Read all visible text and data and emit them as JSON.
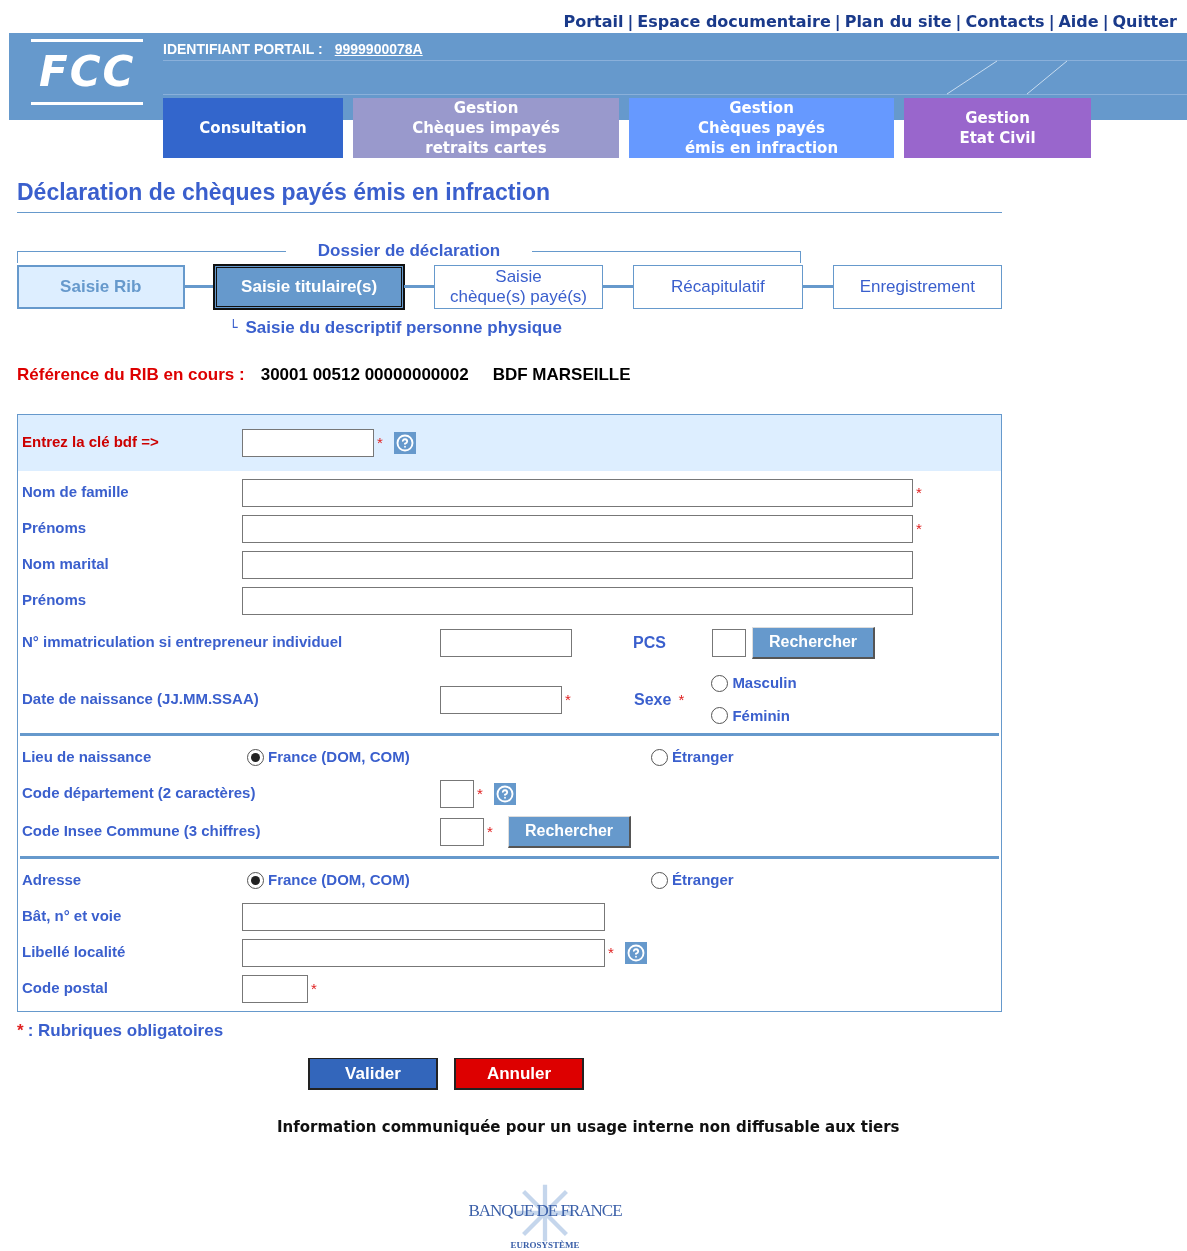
{
  "top_links": {
    "separator": "|",
    "items": [
      "Portail",
      "Espace documentaire",
      "Plan du site",
      "Contacts",
      "Aide",
      "Quitter"
    ]
  },
  "header": {
    "logo": "FCC",
    "portal_id_label": "IDENTIFIANT PORTAIL :",
    "portal_id": "9999900078A"
  },
  "menu_tabs": [
    {
      "lines": [
        "Consultation"
      ],
      "color": "#3366cc"
    },
    {
      "lines": [
        "Gestion",
        "Chèques impayés",
        "retraits cartes"
      ],
      "color": "#9999cc"
    },
    {
      "lines": [
        "Gestion",
        "Chèques payés",
        "émis en infraction"
      ],
      "color": "#6699ff"
    },
    {
      "lines": [
        "Gestion",
        "Etat Civil"
      ],
      "color": "#9966cc"
    }
  ],
  "page_title": "Déclaration de chèques payés émis en infraction",
  "steps": {
    "group_label": "Dossier de déclaration",
    "items": [
      {
        "lines": [
          "Saisie Rib"
        ],
        "kind": "done"
      },
      {
        "lines": [
          "Saisie titulaire(s)"
        ],
        "kind": "current"
      },
      {
        "lines": [
          "Saisie",
          "chèque(s) payé(s)"
        ],
        "kind": "pending"
      },
      {
        "lines": [
          "Récapitulatif"
        ],
        "kind": "pending"
      },
      {
        "lines": [
          "Enregistrement"
        ],
        "kind": "pending"
      }
    ],
    "substep_mark": "└",
    "substep": "Saisie du descriptif personne physique"
  },
  "rib": {
    "label": "Référence du RIB en cours :",
    "value": "30001 00512 00000000002",
    "bank": "BDF MARSEILLE"
  },
  "form": {
    "required_mark": "*",
    "bdf_key": {
      "label": "Entrez la clé bdf =>",
      "required": true,
      "help": true
    },
    "name_fields": [
      {
        "label": "Nom de famille",
        "required": true
      },
      {
        "label": "Prénoms",
        "required": true
      },
      {
        "label": "Nom marital",
        "required": false
      },
      {
        "label": "Prénoms",
        "required": false
      }
    ],
    "registration": {
      "label": "N° immatriculation si entrepreneur individuel"
    },
    "pcs": {
      "label": "PCS",
      "button": "Rechercher"
    },
    "birth_date": {
      "label": "Date de naissance (JJ.MM.SSAA)",
      "required": true
    },
    "sex": {
      "label": "Sexe",
      "required": true,
      "options": [
        {
          "label": "Masculin",
          "selected": false
        },
        {
          "label": "Féminin",
          "selected": false
        }
      ]
    },
    "birth_place": {
      "label": "Lieu de naissance",
      "options": [
        {
          "label": "France (DOM, COM)",
          "selected": true
        },
        {
          "label": "Étranger",
          "selected": false
        }
      ]
    },
    "department": {
      "label": "Code département (2 caractères)",
      "required": true,
      "help": true
    },
    "insee": {
      "label": "Code Insee Commune (3 chiffres)",
      "required": true,
      "button": "Rechercher"
    },
    "address": {
      "label": "Adresse",
      "options": [
        {
          "label": "France (DOM, COM)",
          "selected": true
        },
        {
          "label": "Étranger",
          "selected": false
        }
      ]
    },
    "address_fields": [
      {
        "label": "Bât, n° et voie",
        "required": false,
        "help": false,
        "kind": "long"
      },
      {
        "label": "Libellé localité",
        "required": true,
        "help": true,
        "kind": "long"
      },
      {
        "label": "Code postal",
        "required": true,
        "help": false,
        "kind": "short"
      }
    ]
  },
  "legend": {
    "mark": "*",
    "text": ": Rubriques obligatoires"
  },
  "buttons": [
    {
      "label": "Valider",
      "kind": "primary"
    },
    {
      "label": "Annuler",
      "kind": "cancel"
    }
  ],
  "notice": "Information communiquée pour un usage interne non diffusable aux tiers",
  "footer_logo": {
    "name": "BANQUE DE FRANCE",
    "sub": "EUROSYSTÈME"
  }
}
